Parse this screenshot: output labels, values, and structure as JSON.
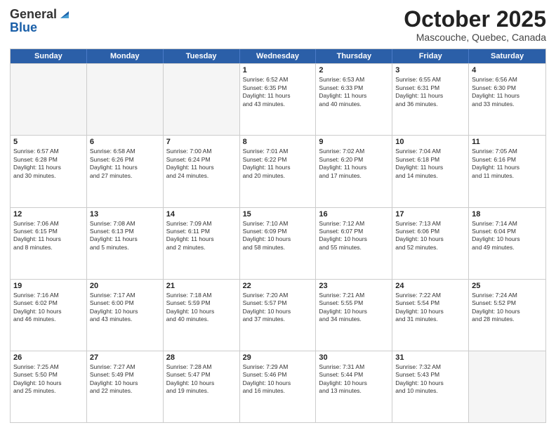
{
  "header": {
    "logo_general": "General",
    "logo_blue": "Blue",
    "month_title": "October 2025",
    "subtitle": "Mascouche, Quebec, Canada"
  },
  "weekdays": [
    "Sunday",
    "Monday",
    "Tuesday",
    "Wednesday",
    "Thursday",
    "Friday",
    "Saturday"
  ],
  "rows": [
    [
      {
        "day": "",
        "info": "",
        "empty": true
      },
      {
        "day": "",
        "info": "",
        "empty": true
      },
      {
        "day": "",
        "info": "",
        "empty": true
      },
      {
        "day": "1",
        "info": "Sunrise: 6:52 AM\nSunset: 6:35 PM\nDaylight: 11 hours\nand 43 minutes.",
        "empty": false
      },
      {
        "day": "2",
        "info": "Sunrise: 6:53 AM\nSunset: 6:33 PM\nDaylight: 11 hours\nand 40 minutes.",
        "empty": false
      },
      {
        "day": "3",
        "info": "Sunrise: 6:55 AM\nSunset: 6:31 PM\nDaylight: 11 hours\nand 36 minutes.",
        "empty": false
      },
      {
        "day": "4",
        "info": "Sunrise: 6:56 AM\nSunset: 6:30 PM\nDaylight: 11 hours\nand 33 minutes.",
        "empty": false
      }
    ],
    [
      {
        "day": "5",
        "info": "Sunrise: 6:57 AM\nSunset: 6:28 PM\nDaylight: 11 hours\nand 30 minutes.",
        "empty": false
      },
      {
        "day": "6",
        "info": "Sunrise: 6:58 AM\nSunset: 6:26 PM\nDaylight: 11 hours\nand 27 minutes.",
        "empty": false
      },
      {
        "day": "7",
        "info": "Sunrise: 7:00 AM\nSunset: 6:24 PM\nDaylight: 11 hours\nand 24 minutes.",
        "empty": false
      },
      {
        "day": "8",
        "info": "Sunrise: 7:01 AM\nSunset: 6:22 PM\nDaylight: 11 hours\nand 20 minutes.",
        "empty": false
      },
      {
        "day": "9",
        "info": "Sunrise: 7:02 AM\nSunset: 6:20 PM\nDaylight: 11 hours\nand 17 minutes.",
        "empty": false
      },
      {
        "day": "10",
        "info": "Sunrise: 7:04 AM\nSunset: 6:18 PM\nDaylight: 11 hours\nand 14 minutes.",
        "empty": false
      },
      {
        "day": "11",
        "info": "Sunrise: 7:05 AM\nSunset: 6:16 PM\nDaylight: 11 hours\nand 11 minutes.",
        "empty": false
      }
    ],
    [
      {
        "day": "12",
        "info": "Sunrise: 7:06 AM\nSunset: 6:15 PM\nDaylight: 11 hours\nand 8 minutes.",
        "empty": false
      },
      {
        "day": "13",
        "info": "Sunrise: 7:08 AM\nSunset: 6:13 PM\nDaylight: 11 hours\nand 5 minutes.",
        "empty": false
      },
      {
        "day": "14",
        "info": "Sunrise: 7:09 AM\nSunset: 6:11 PM\nDaylight: 11 hours\nand 2 minutes.",
        "empty": false
      },
      {
        "day": "15",
        "info": "Sunrise: 7:10 AM\nSunset: 6:09 PM\nDaylight: 10 hours\nand 58 minutes.",
        "empty": false
      },
      {
        "day": "16",
        "info": "Sunrise: 7:12 AM\nSunset: 6:07 PM\nDaylight: 10 hours\nand 55 minutes.",
        "empty": false
      },
      {
        "day": "17",
        "info": "Sunrise: 7:13 AM\nSunset: 6:06 PM\nDaylight: 10 hours\nand 52 minutes.",
        "empty": false
      },
      {
        "day": "18",
        "info": "Sunrise: 7:14 AM\nSunset: 6:04 PM\nDaylight: 10 hours\nand 49 minutes.",
        "empty": false
      }
    ],
    [
      {
        "day": "19",
        "info": "Sunrise: 7:16 AM\nSunset: 6:02 PM\nDaylight: 10 hours\nand 46 minutes.",
        "empty": false
      },
      {
        "day": "20",
        "info": "Sunrise: 7:17 AM\nSunset: 6:00 PM\nDaylight: 10 hours\nand 43 minutes.",
        "empty": false
      },
      {
        "day": "21",
        "info": "Sunrise: 7:18 AM\nSunset: 5:59 PM\nDaylight: 10 hours\nand 40 minutes.",
        "empty": false
      },
      {
        "day": "22",
        "info": "Sunrise: 7:20 AM\nSunset: 5:57 PM\nDaylight: 10 hours\nand 37 minutes.",
        "empty": false
      },
      {
        "day": "23",
        "info": "Sunrise: 7:21 AM\nSunset: 5:55 PM\nDaylight: 10 hours\nand 34 minutes.",
        "empty": false
      },
      {
        "day": "24",
        "info": "Sunrise: 7:22 AM\nSunset: 5:54 PM\nDaylight: 10 hours\nand 31 minutes.",
        "empty": false
      },
      {
        "day": "25",
        "info": "Sunrise: 7:24 AM\nSunset: 5:52 PM\nDaylight: 10 hours\nand 28 minutes.",
        "empty": false
      }
    ],
    [
      {
        "day": "26",
        "info": "Sunrise: 7:25 AM\nSunset: 5:50 PM\nDaylight: 10 hours\nand 25 minutes.",
        "empty": false
      },
      {
        "day": "27",
        "info": "Sunrise: 7:27 AM\nSunset: 5:49 PM\nDaylight: 10 hours\nand 22 minutes.",
        "empty": false
      },
      {
        "day": "28",
        "info": "Sunrise: 7:28 AM\nSunset: 5:47 PM\nDaylight: 10 hours\nand 19 minutes.",
        "empty": false
      },
      {
        "day": "29",
        "info": "Sunrise: 7:29 AM\nSunset: 5:46 PM\nDaylight: 10 hours\nand 16 minutes.",
        "empty": false
      },
      {
        "day": "30",
        "info": "Sunrise: 7:31 AM\nSunset: 5:44 PM\nDaylight: 10 hours\nand 13 minutes.",
        "empty": false
      },
      {
        "day": "31",
        "info": "Sunrise: 7:32 AM\nSunset: 5:43 PM\nDaylight: 10 hours\nand 10 minutes.",
        "empty": false
      },
      {
        "day": "",
        "info": "",
        "empty": true
      }
    ]
  ]
}
